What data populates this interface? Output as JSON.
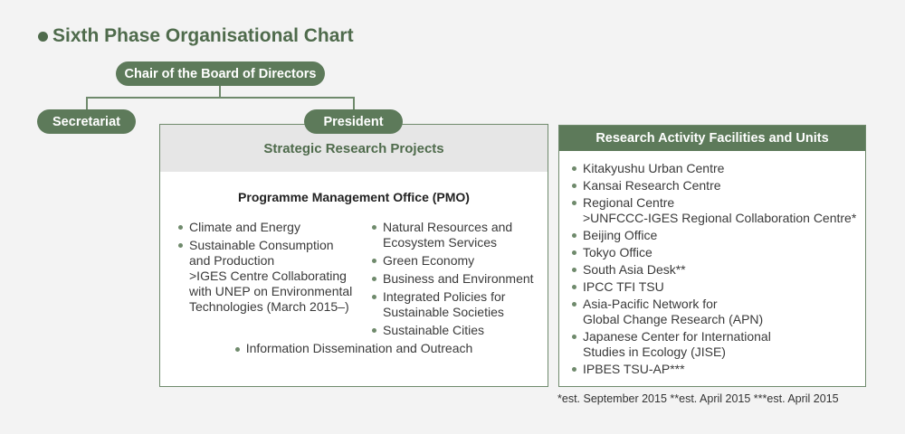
{
  "title": "Sixth Phase Organisational Chart",
  "nodes": {
    "chair": "Chair of the Board of Directors",
    "secretariat": "Secretariat",
    "president": "President"
  },
  "strategic": {
    "heading": "Strategic Research Projects",
    "pmo": "Programme Management Office (PMO)",
    "left_items": [
      {
        "lines": [
          "Climate and Energy"
        ]
      },
      {
        "lines": [
          "Sustainable Consumption",
          "and Production",
          ">IGES Centre Collaborating",
          "with UNEP on Environmental",
          "Technologies (March 2015–)"
        ]
      }
    ],
    "right_items": [
      {
        "lines": [
          "Natural Resources and",
          "Ecosystem Services"
        ]
      },
      {
        "lines": [
          "Green Economy"
        ]
      },
      {
        "lines": [
          "Business and Environment"
        ]
      },
      {
        "lines": [
          "Integrated Policies for",
          "Sustainable Societies"
        ]
      },
      {
        "lines": [
          "Sustainable Cities"
        ]
      }
    ],
    "bottom_item": "Information Dissemination and Outreach"
  },
  "research": {
    "heading": "Research Activity Facilities and Units",
    "items": [
      {
        "lines": [
          "Kitakyushu Urban Centre"
        ]
      },
      {
        "lines": [
          "Kansai Research Centre"
        ]
      },
      {
        "lines": [
          "Regional Centre",
          ">UNFCCC-IGES Regional Collaboration Centre*"
        ]
      },
      {
        "lines": [
          "Beijing Office"
        ]
      },
      {
        "lines": [
          "Tokyo Office"
        ]
      },
      {
        "lines": [
          "South Asia Desk**"
        ]
      },
      {
        "lines": [
          "IPCC TFI TSU"
        ]
      },
      {
        "lines": [
          "Asia-Pacific Network for",
          "Global Change Research (APN)"
        ]
      },
      {
        "lines": [
          "Japanese Center for International",
          "Studies in Ecology (JISE)"
        ]
      },
      {
        "lines": [
          "IPBES TSU-AP***"
        ]
      }
    ]
  },
  "footnote": "*est. September 2015  **est. April 2015  ***est. April 2015"
}
